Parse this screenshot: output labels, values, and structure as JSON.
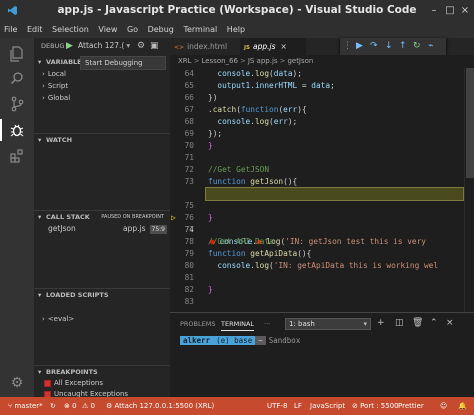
{
  "window": {
    "title": "app.js - Javascript Practice (Workspace) - Visual Studio Code"
  },
  "menu": [
    "File",
    "Edit",
    "Selection",
    "View",
    "Go",
    "Debug",
    "Terminal",
    "Help"
  ],
  "debug_toolbar": {
    "label": "DEBUG",
    "config": "Attach 127.("
  },
  "tooltip": "Start Debugging",
  "sidebar": {
    "variables": {
      "title": "VARIABLES",
      "items": [
        "Local",
        "Script",
        "Global"
      ]
    },
    "watch": {
      "title": "WATCH"
    },
    "call_stack": {
      "title": "CALL STACK",
      "status": "PAUSED ON BREAKPOINT",
      "frame": "getJson",
      "file": "app.js",
      "position": "75:9"
    },
    "loaded_scripts": {
      "title": "LOADED SCRIPTS",
      "items": [
        "<eval>"
      ]
    },
    "breakpoints": {
      "title": "BREAKPOINTS",
      "items": [
        "All Exceptions",
        "Uncaught Exceptions"
      ]
    }
  },
  "tabs": [
    {
      "label": "index.html",
      "badge": "<>"
    },
    {
      "label": "app.js",
      "badge": "JS",
      "close": "×"
    }
  ],
  "breadcrumb": {
    "parts": [
      "XRL",
      "Lesson_66",
      "JS app.js",
      "getJson"
    ],
    "separator": ">"
  },
  "editor": {
    "line_numbers": [
      "64",
      "65",
      "66",
      "67",
      "68",
      "69",
      "70",
      "71",
      "72",
      "73",
      "74",
      "75",
      "76",
      "77",
      "78",
      "79",
      "80",
      "81",
      "82",
      "83",
      "84"
    ],
    "current_line": "75"
  },
  "panel": {
    "tabs": [
      "PROBLEMS",
      "TERMINAL"
    ],
    "dash": "···",
    "terminal_select": "1: bash",
    "prompt": {
      "user": "alkerr",
      "env": "(e) base",
      "arrow": "~",
      "dir": "Sandbox"
    }
  },
  "status_bar": {
    "branch": "master*",
    "sync": "↻",
    "errors": "⊗ 0",
    "warnings": "⚠ 0",
    "attach": "Attach 127.0.0.1:5500 (XRL)",
    "encoding": "UTF-8",
    "eol": "LF",
    "language": "JavaScript",
    "port": "⊘ Port : 5500",
    "formatter": "Prettier"
  },
  "colors": {
    "statusbar": "#c54a2e",
    "activity_bar": "#333333",
    "sidebar": "#252526",
    "editor": "#1e1e1e"
  }
}
